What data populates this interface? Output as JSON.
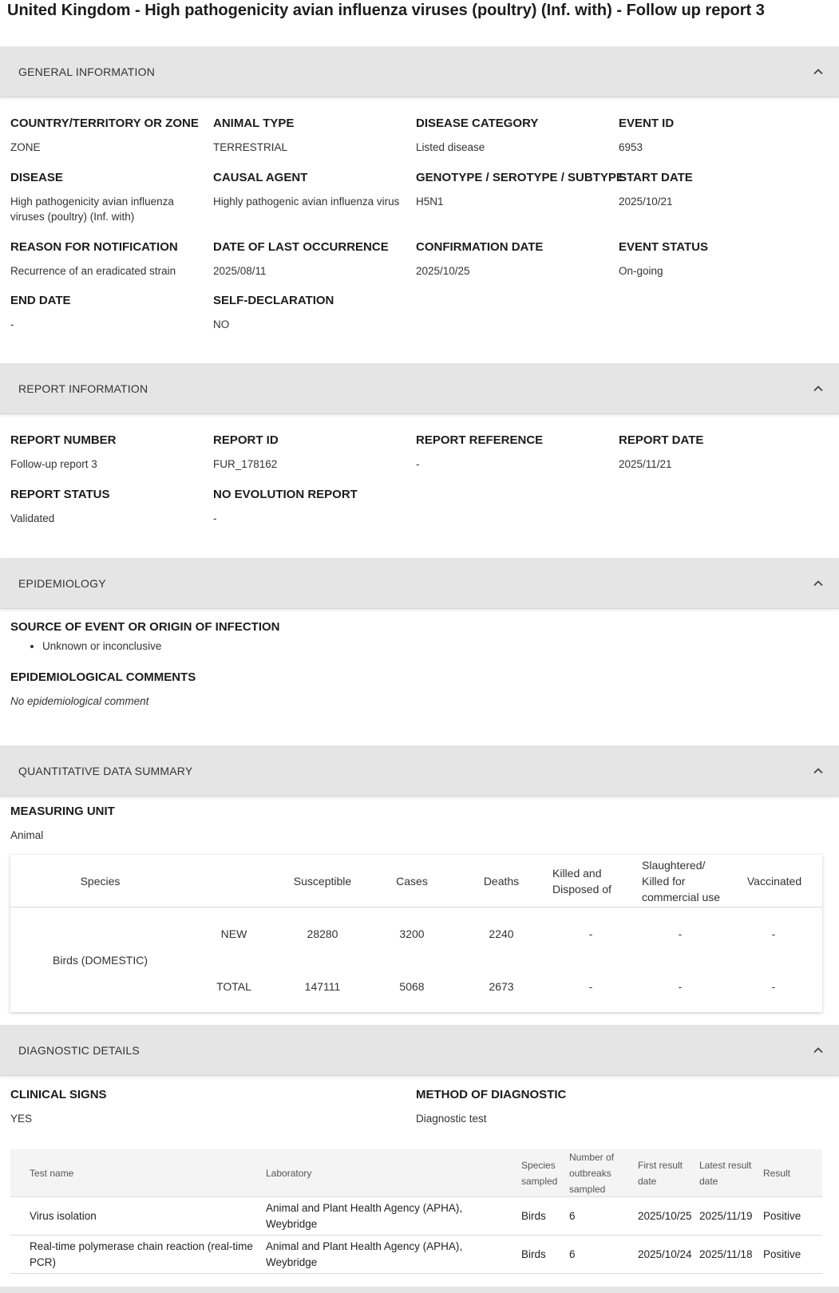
{
  "page": {
    "title": "United Kingdom - High pathogenicity avian influenza viruses (poultry) (Inf. with) - Follow up report 3"
  },
  "general": {
    "header": "GENERAL INFORMATION",
    "fields": [
      {
        "label": "COUNTRY/TERRITORY OR ZONE",
        "value": "ZONE"
      },
      {
        "label": "ANIMAL TYPE",
        "value": "TERRESTRIAL"
      },
      {
        "label": "DISEASE CATEGORY",
        "value": "Listed disease"
      },
      {
        "label": "EVENT ID",
        "value": "6953"
      },
      {
        "label": "DISEASE",
        "value": "High pathogenicity avian influenza viruses (poultry) (Inf. with)"
      },
      {
        "label": "CAUSAL AGENT",
        "value": "Highly pathogenic avian influenza virus"
      },
      {
        "label": "GENOTYPE / SEROTYPE / SUBTYPE",
        "value": "H5N1"
      },
      {
        "label": "START DATE",
        "value": "2025/10/21"
      },
      {
        "label": "REASON FOR NOTIFICATION",
        "value": "Recurrence of an eradicated strain"
      },
      {
        "label": "DATE OF LAST OCCURRENCE",
        "value": "2025/08/11"
      },
      {
        "label": "CONFIRMATION DATE",
        "value": "2025/10/25"
      },
      {
        "label": "EVENT STATUS",
        "value": "On-going"
      },
      {
        "label": "END DATE",
        "value": "-"
      },
      {
        "label": "SELF-DECLARATION",
        "value": "NO"
      }
    ]
  },
  "report": {
    "header": "REPORT INFORMATION",
    "fields": [
      {
        "label": "REPORT NUMBER",
        "value": "Follow-up report 3"
      },
      {
        "label": "REPORT ID",
        "value": "FUR_178162"
      },
      {
        "label": "REPORT REFERENCE",
        "value": "-"
      },
      {
        "label": "REPORT DATE",
        "value": "2025/11/21"
      },
      {
        "label": "REPORT STATUS",
        "value": "Validated"
      },
      {
        "label": "NO EVOLUTION REPORT",
        "value": "-"
      }
    ]
  },
  "epidemiology": {
    "header": "EPIDEMIOLOGY",
    "source_label": "SOURCE OF EVENT OR ORIGIN OF INFECTION",
    "sources": [
      "Unknown or inconclusive"
    ],
    "comments_label": "EPIDEMIOLOGICAL COMMENTS",
    "comments_value": "No epidemiological comment"
  },
  "quantitative": {
    "header": "QUANTITATIVE DATA SUMMARY",
    "unit_label": "MEASURING UNIT",
    "unit_value": "Animal",
    "columns": [
      "Species",
      "Susceptible",
      "Cases",
      "Deaths",
      "Killed and Disposed of",
      "Slaughtered/ Killed for commercial use",
      "Vaccinated"
    ],
    "species": "Birds (DOMESTIC)",
    "rows": [
      {
        "type": "NEW",
        "susceptible": "28280",
        "cases": "3200",
        "deaths": "2240",
        "killed": "-",
        "slaughtered": "-",
        "vaccinated": "-"
      },
      {
        "type": "TOTAL",
        "susceptible": "147111",
        "cases": "5068",
        "deaths": "2673",
        "killed": "-",
        "slaughtered": "-",
        "vaccinated": "-"
      }
    ]
  },
  "diagnostic": {
    "header": "DIAGNOSTIC DETAILS",
    "clinical_label": "CLINICAL SIGNS",
    "clinical_value": "YES",
    "method_label": "METHOD OF DIAGNOSTIC",
    "method_value": "Diagnostic test",
    "columns": [
      "Test name",
      "Laboratory",
      "Species sampled",
      "Number of outbreaks sampled",
      "First result date",
      "Latest result date",
      "Result"
    ],
    "rows": [
      {
        "test": "Virus isolation",
        "lab": "Animal and Plant Health Agency (APHA), Weybridge",
        "species": "Birds",
        "outbreaks": "6",
        "first": "2025/10/25",
        "latest": "2025/11/19",
        "result": "Positive"
      },
      {
        "test": "Real-time polymerase chain reaction (real-time PCR)",
        "lab": "Animal and Plant Health Agency (APHA), Weybridge",
        "species": "Birds",
        "outbreaks": "6",
        "first": "2025/10/24",
        "latest": "2025/11/18",
        "result": "Positive"
      }
    ]
  },
  "icons": {
    "collapse": "chevron-up-icon"
  }
}
